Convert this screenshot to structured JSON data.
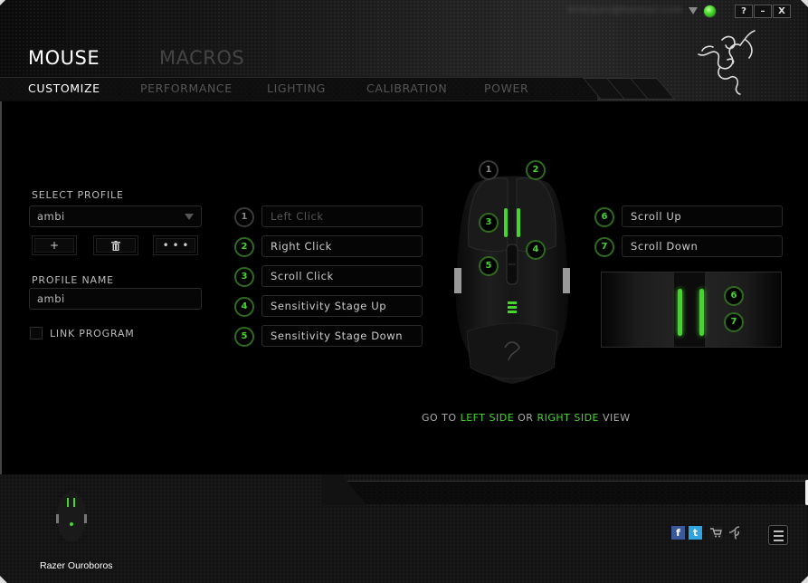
{
  "window": {
    "account_email": "kristaurs@hotmail.com",
    "status": "online",
    "buttons": {
      "help": "?",
      "minimize": "–",
      "close": "X"
    }
  },
  "main_tabs": [
    {
      "label": "MOUSE",
      "active": true
    },
    {
      "label": "MACROS",
      "active": false
    }
  ],
  "sub_tabs": [
    {
      "label": "CUSTOMIZE",
      "active": true
    },
    {
      "label": "PERFORMANCE",
      "active": false
    },
    {
      "label": "LIGHTING",
      "active": false
    },
    {
      "label": "CALIBRATION",
      "active": false
    },
    {
      "label": "POWER",
      "active": false
    }
  ],
  "profile": {
    "select_label": "SELECT PROFILE",
    "selected": "ambi",
    "add_label": "+",
    "delete_icon": "trash-icon",
    "more_label": "• • •",
    "name_label": "PROFILE NAME",
    "name_value": "ambi",
    "link_program_label": "LINK PROGRAM",
    "link_program_checked": false
  },
  "button_assignments": [
    {
      "num": "1",
      "label": "Left Click",
      "disabled": true
    },
    {
      "num": "2",
      "label": "Right Click",
      "disabled": false
    },
    {
      "num": "3",
      "label": "Scroll Click",
      "disabled": false
    },
    {
      "num": "4",
      "label": "Sensitivity Stage Up",
      "disabled": false
    },
    {
      "num": "5",
      "label": "Sensitivity Stage Down",
      "disabled": false
    },
    {
      "num": "6",
      "label": "Scroll Up",
      "disabled": false
    },
    {
      "num": "7",
      "label": "Scroll Down",
      "disabled": false
    }
  ],
  "goto": {
    "prefix": "GO TO",
    "left": "LEFT SIDE",
    "or": "OR",
    "right": "RIGHT SIDE",
    "suffix": "VIEW"
  },
  "footer": {
    "device_name": "Razer Ouroboros",
    "social": [
      "facebook-icon",
      "twitter-icon",
      "store-icon",
      "razer-icon"
    ],
    "menu_icon": "hamburger-menu-icon"
  },
  "colors": {
    "accent": "#44d62c",
    "background": "#000000"
  }
}
